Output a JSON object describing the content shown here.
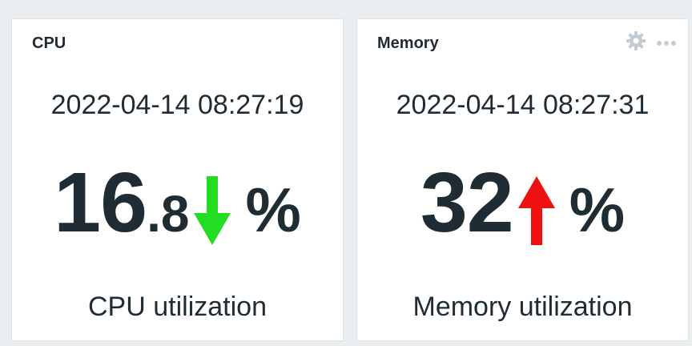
{
  "widgets": {
    "cpu": {
      "title": "CPU",
      "timestamp": "2022-04-14 08:27:19",
      "value_int": "16",
      "value_dec": ".8",
      "trend": "down",
      "trend_icon": "arrow-down-icon",
      "trend_color": "#22dd22",
      "unit": "%",
      "description": "CPU utilization"
    },
    "memory": {
      "title": "Memory",
      "timestamp": "2022-04-14 08:27:31",
      "value_int": "32",
      "value_dec": "",
      "trend": "up",
      "trend_icon": "arrow-up-icon",
      "trend_color": "#ee1111",
      "unit": "%",
      "description": "Memory utilization",
      "actions": {
        "settings_icon": "gear-icon",
        "more_icon": "more-icon"
      }
    }
  },
  "colors": {
    "dashboard_bg": "#ebeef0",
    "widget_bg": "#ffffff",
    "text": "#1f2c33",
    "action_icon": "#c5ccd1"
  }
}
